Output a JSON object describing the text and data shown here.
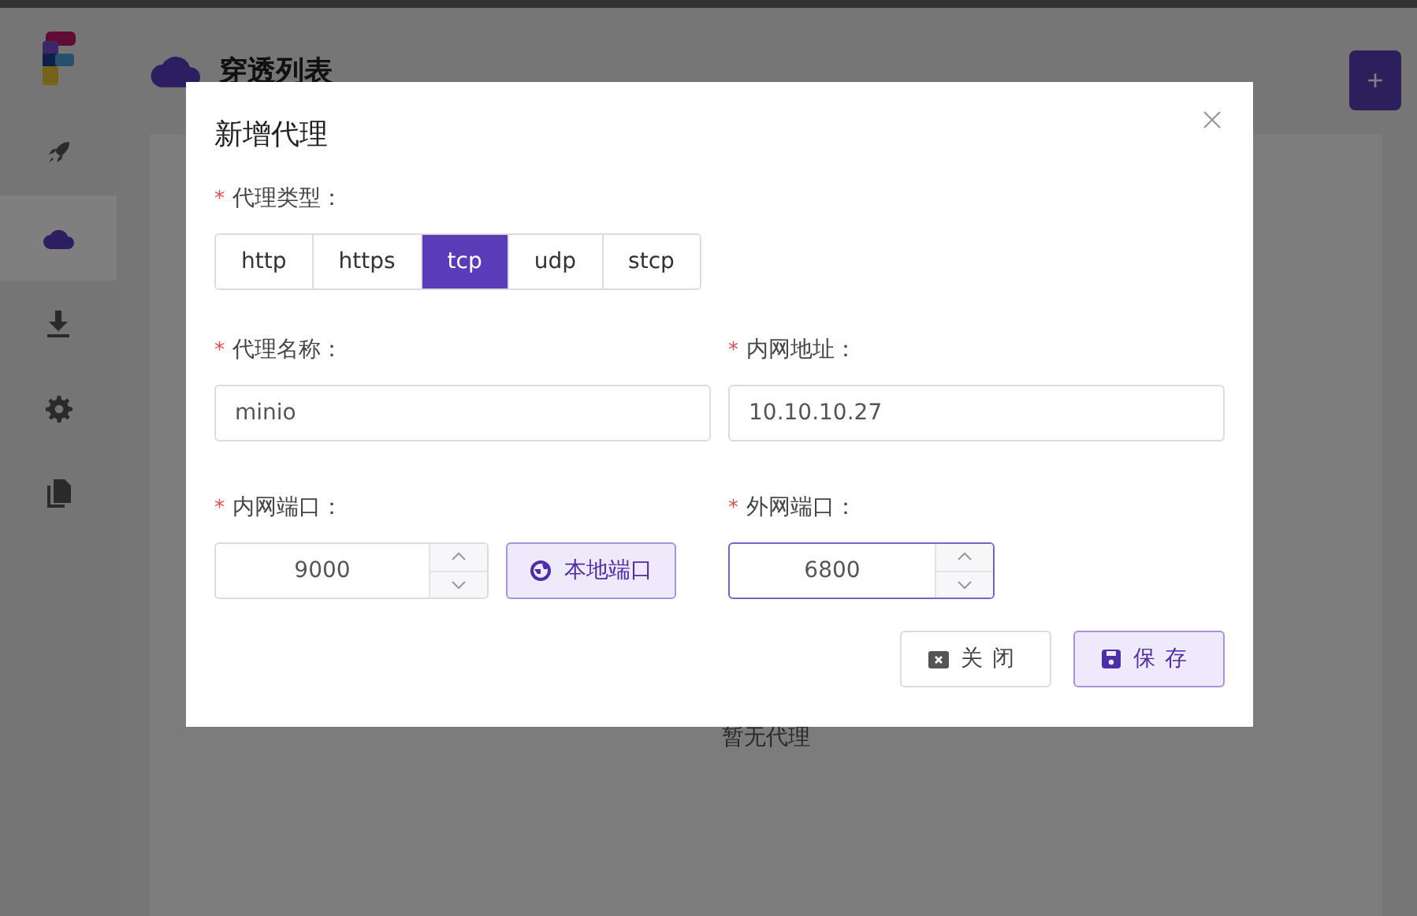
{
  "sidebar": {
    "items": [
      {
        "kind": "rocket",
        "selected": false
      },
      {
        "kind": "cloud",
        "selected": true
      },
      {
        "kind": "download",
        "selected": false
      },
      {
        "kind": "gear",
        "selected": false
      },
      {
        "kind": "files",
        "selected": false
      }
    ]
  },
  "header": {
    "title": "穿透列表"
  },
  "add_button": {
    "label": "+"
  },
  "empty_text": "暂无代理",
  "dialog": {
    "title": "新增代理",
    "type_field": {
      "required_mark": "*",
      "label": "代理类型：",
      "options": [
        {
          "label": "http",
          "selected": false
        },
        {
          "label": "https",
          "selected": false
        },
        {
          "label": "tcp",
          "selected": true
        },
        {
          "label": "udp",
          "selected": false
        },
        {
          "label": "stcp",
          "selected": false
        }
      ]
    },
    "name_field": {
      "required_mark": "*",
      "label": "代理名称：",
      "value": "minio"
    },
    "address_field": {
      "required_mark": "*",
      "label": "内网地址：",
      "value": "10.10.10.27"
    },
    "local_port_field": {
      "required_mark": "*",
      "label": "内网端口：",
      "value": "9000",
      "focused": false
    },
    "local_port_button": {
      "label": "本地端口"
    },
    "remote_port_field": {
      "required_mark": "*",
      "label": "外网端口：",
      "value": "6800",
      "focused": true
    },
    "buttons": [
      {
        "kind": "close",
        "label": "关闭"
      },
      {
        "kind": "save",
        "label": "保存"
      }
    ]
  }
}
